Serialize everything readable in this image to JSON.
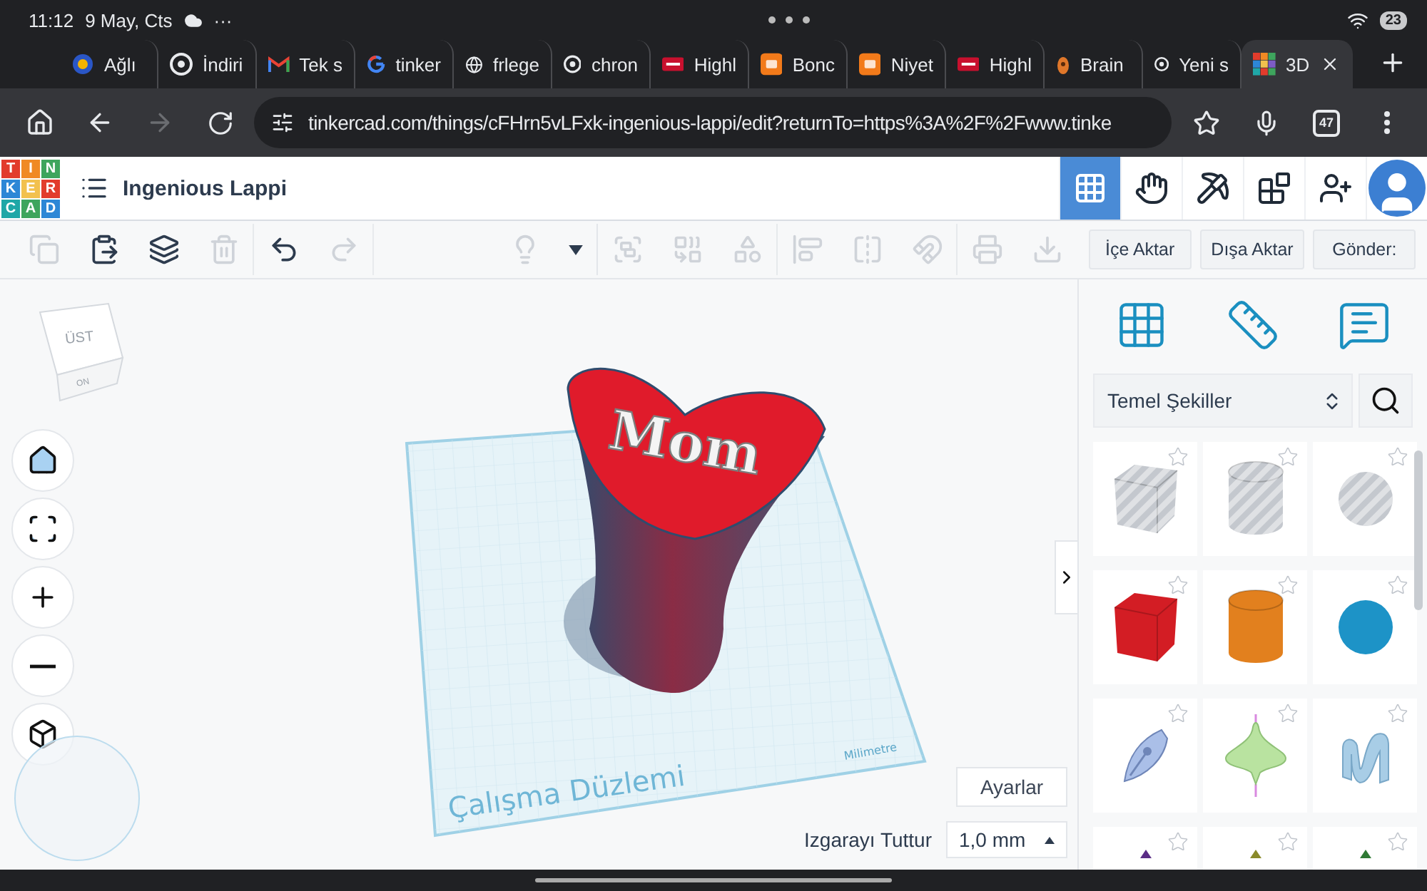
{
  "status_bar": {
    "time": "11:12",
    "date": "9 May, Cts",
    "more": "···",
    "battery": "23"
  },
  "browser_tabs": [
    {
      "kind": "agli",
      "title": "Ağlı",
      "selected": false
    },
    {
      "kind": "chrome",
      "title": "İndiri",
      "selected": false
    },
    {
      "kind": "gmail",
      "title": "Tek s",
      "selected": false
    },
    {
      "kind": "google",
      "title": "tinker",
      "selected": false
    },
    {
      "kind": "globe",
      "title": "frlege",
      "selected": false
    },
    {
      "kind": "chrome",
      "title": "chron",
      "selected": false
    },
    {
      "kind": "highlight",
      "title": "Highl",
      "selected": false
    },
    {
      "kind": "hb",
      "title": "Bonc",
      "selected": false
    },
    {
      "kind": "hb",
      "title": "Niyet",
      "selected": false
    },
    {
      "kind": "highlight",
      "title": "Highl",
      "selected": false
    },
    {
      "kind": "brain",
      "title": "Brain",
      "selected": false
    },
    {
      "kind": "chrome",
      "title": "Yeni s",
      "selected": false
    },
    {
      "kind": "tinkercad",
      "title": "3D",
      "selected": true
    }
  ],
  "address_bar": {
    "url": "tinkercad.com/things/cFHrn5vLFxk-ingenious-lappi/edit?returnTo=https%3A%2F%2Fwww.tinke",
    "tab_count": "47"
  },
  "app_header": {
    "logo": [
      "T",
      "I",
      "N",
      "K",
      "E",
      "R",
      "C",
      "A",
      "D"
    ],
    "title": "Ingenious Lappi",
    "tools": [
      {
        "kind": "grid",
        "selected": true
      },
      {
        "kind": "hand",
        "selected": false
      },
      {
        "kind": "pickaxe",
        "selected": false
      },
      {
        "kind": "brick",
        "selected": false
      },
      {
        "kind": "add-user",
        "selected": false
      },
      {
        "kind": "avatar",
        "selected": false
      }
    ]
  },
  "toolbar": {
    "edit_tools": [
      {
        "kind": "copy",
        "disabled": true
      },
      {
        "kind": "paste",
        "disabled": false
      },
      {
        "kind": "duplicate",
        "disabled": false
      },
      {
        "kind": "delete",
        "disabled": true
      },
      {
        "kind": "undo",
        "disabled": false
      },
      {
        "kind": "redo",
        "disabled": true
      }
    ],
    "shape_tools": [
      {
        "kind": "bulb",
        "disabled": true
      },
      {
        "kind": "caret",
        "disabled": false
      },
      {
        "kind": "group",
        "disabled": true
      },
      {
        "kind": "ungroup",
        "disabled": true
      },
      {
        "kind": "hole",
        "disabled": true
      },
      {
        "kind": "align",
        "disabled": true
      },
      {
        "kind": "mirror",
        "disabled": true
      },
      {
        "kind": "magnet",
        "disabled": true
      },
      {
        "kind": "print",
        "disabled": true
      },
      {
        "kind": "drop",
        "disabled": true
      }
    ],
    "buttons": [
      "İçe Aktar",
      "Dışa Aktar",
      "Gönder:"
    ]
  },
  "viewport": {
    "view_cube": {
      "top": "ÜST",
      "front": "ON"
    },
    "nav_buttons": [
      {
        "kind": "home"
      },
      {
        "kind": "fit"
      },
      {
        "kind": "zoom-in"
      },
      {
        "kind": "zoom-out"
      },
      {
        "kind": "perspective"
      }
    ],
    "workplane": {
      "label": "Çalışma Düzlemi",
      "unit": "Milimetre"
    },
    "object_text": "Mom",
    "settings_button": "Ayarlar",
    "snap": {
      "label": "Izgarayı Tuttur",
      "value": "1,0 mm"
    }
  },
  "shapes_panel": {
    "tools": [
      {
        "kind": "grid"
      },
      {
        "kind": "ruler"
      },
      {
        "kind": "note"
      }
    ],
    "category": "Temel Şekiller",
    "shapes": [
      {
        "kind": "box",
        "color": "#c4c8ce",
        "hole": true
      },
      {
        "kind": "cylinder",
        "color": "#c4c8ce",
        "hole": true
      },
      {
        "kind": "sphere",
        "color": "#c4c8ce",
        "hole": true
      },
      {
        "kind": "box",
        "color": "#d31d24",
        "hole": false
      },
      {
        "kind": "cylinder",
        "color": "#e2801e",
        "hole": false
      },
      {
        "kind": "sphere",
        "color": "#1d93c7",
        "hole": false
      },
      {
        "kind": "nib",
        "color": "#aabfe8"
      },
      {
        "kind": "top",
        "color": "#b9e3a0"
      },
      {
        "kind": "wave",
        "color": "#a8cde6"
      },
      {
        "kind": "cut",
        "color": "#5b2d86"
      },
      {
        "kind": "cut",
        "color": "#8a8a2a"
      },
      {
        "kind": "cut",
        "color": "#2f7a35"
      }
    ]
  }
}
